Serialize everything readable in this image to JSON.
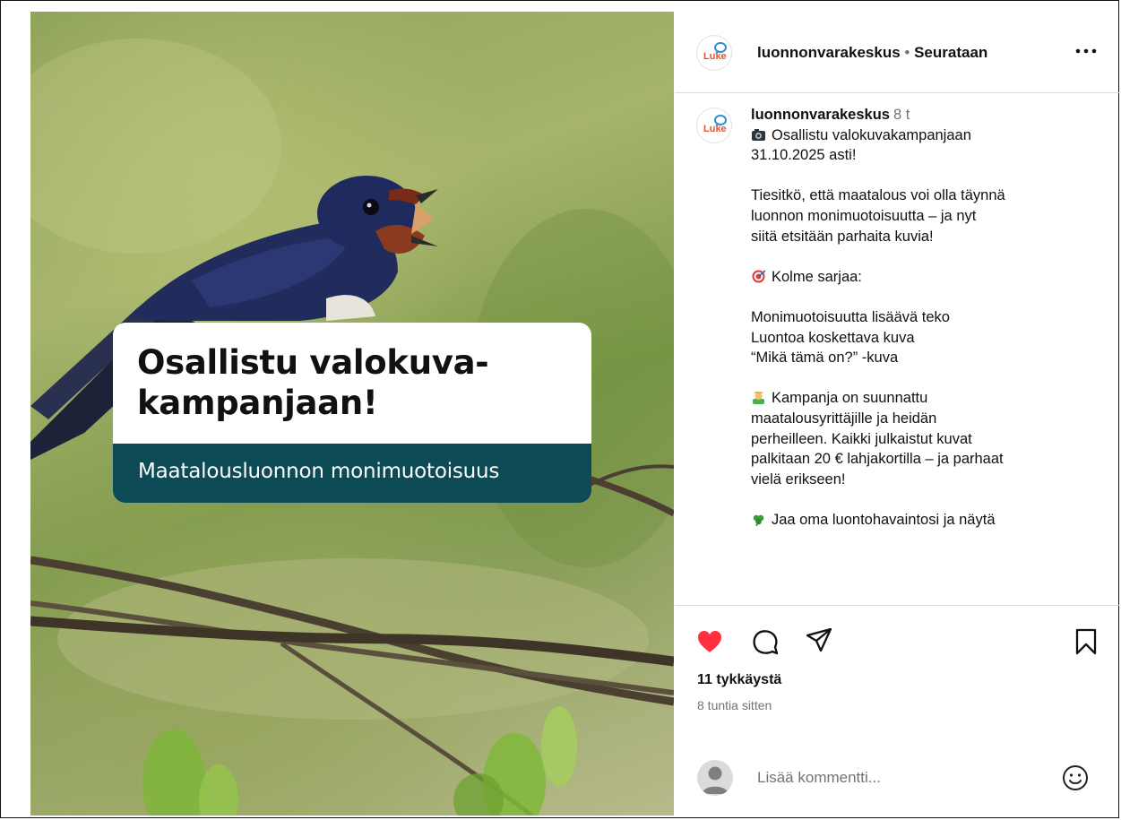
{
  "post_image": {
    "headline": "Osallistu valokuva-kampanjaan!",
    "subtitle": "Maatalousluonnon monimuotoisuus"
  },
  "header": {
    "logo_text": "Luke",
    "username": "luonnonvarakeskus",
    "separator": "•",
    "follow_status": "Seurataan",
    "more_icon": "more-horizontal-icon"
  },
  "caption": {
    "username": "luonnonvarakeskus",
    "time": "8 t",
    "lines": [
      {
        "icon": "camera-emoji",
        "text": "Osallistu valokuvakampanjaan"
      },
      {
        "text": "31.10.2025 asti!"
      },
      {
        "gap": true
      },
      {
        "text": "Tiesitkö, että maatalous voi olla täynnä"
      },
      {
        "text": "luonnon monimuotoisuutta – ja nyt"
      },
      {
        "text": "siitä etsitään parhaita kuvia!"
      },
      {
        "gap": true
      },
      {
        "icon": "target-emoji",
        "text": "Kolme sarjaa:"
      },
      {
        "gap": true
      },
      {
        "text": "Monimuotoisuutta lisäävä teko"
      },
      {
        "text": "Luontoa koskettava kuva"
      },
      {
        "text": "“Mikä tämä on?” -kuva"
      },
      {
        "gap": true
      },
      {
        "icon": "farmer-emoji",
        "text": "Kampanja on suunnattu"
      },
      {
        "text": "maatalousyrittäjille ja heidän"
      },
      {
        "text": "perheilleen. Kaikki julkaistut kuvat"
      },
      {
        "text": "palkitaan 20 € lahjakortilla – ja parhaat"
      },
      {
        "text": "vielä erikseen!"
      },
      {
        "gap": true
      },
      {
        "icon": "clover-emoji",
        "text": "Jaa oma luontohavaintosi ja näytä"
      }
    ]
  },
  "actions": {
    "icons": [
      "heart-filled-icon",
      "comment-icon",
      "share-icon",
      "bookmark-icon"
    ],
    "heart_color": "#ff3040",
    "likes_text": "11 tykkäystä",
    "time_ago": "8 tuntia sitten"
  },
  "comment_box": {
    "placeholder": "Lisää kommentti...",
    "emoji_icon": "emoji-smile-icon"
  }
}
